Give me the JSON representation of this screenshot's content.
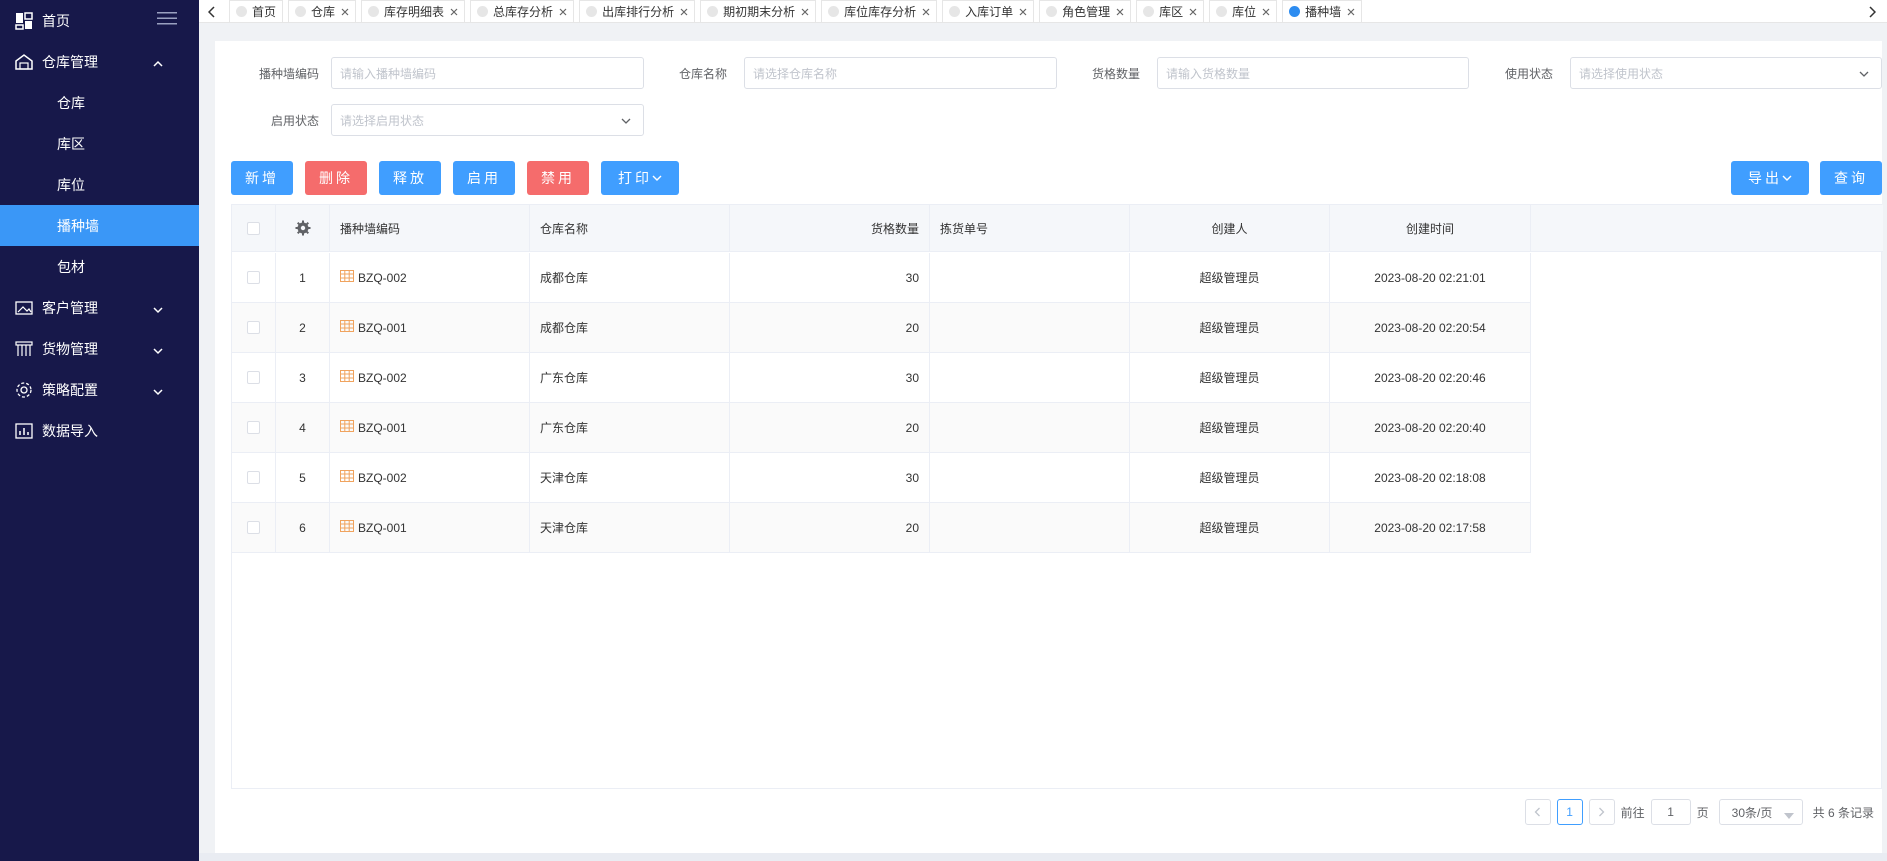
{
  "sidebar": {
    "home": "首页",
    "warehouse_mgmt": "仓库管理",
    "sub": [
      "仓库",
      "库区",
      "库位",
      "播种墙",
      "包材"
    ],
    "active_sub": 3,
    "customer_mgmt": "客户管理",
    "goods_mgmt": "货物管理",
    "strategy_config": "策略配置",
    "data_import": "数据导入"
  },
  "tabs": [
    {
      "label": "首页",
      "closable": false,
      "active": false
    },
    {
      "label": "仓库",
      "closable": true,
      "active": false
    },
    {
      "label": "库存明细表",
      "closable": true,
      "active": false
    },
    {
      "label": "总库存分析",
      "closable": true,
      "active": false
    },
    {
      "label": "出库排行分析",
      "closable": true,
      "active": false
    },
    {
      "label": "期初期末分析",
      "closable": true,
      "active": false
    },
    {
      "label": "库位库存分析",
      "closable": true,
      "active": false
    },
    {
      "label": "入库订单",
      "closable": true,
      "active": false
    },
    {
      "label": "角色管理",
      "closable": true,
      "active": false
    },
    {
      "label": "库区",
      "closable": true,
      "active": false
    },
    {
      "label": "库位",
      "closable": true,
      "active": false
    },
    {
      "label": "播种墙",
      "closable": true,
      "active": true
    }
  ],
  "filters": {
    "code_label": "播种墙编码",
    "code_placeholder": "请输入播种墙编码",
    "wh_label": "仓库名称",
    "wh_placeholder": "请选择仓库名称",
    "qty_label": "货格数量",
    "qty_placeholder": "请输入货格数量",
    "use_label": "使用状态",
    "use_placeholder": "请选择使用状态",
    "enable_label": "启用状态",
    "enable_placeholder": "请选择启用状态"
  },
  "toolbar": {
    "add": "新增",
    "delete": "删除",
    "release": "释放",
    "enable": "启用",
    "disable": "禁用",
    "print": "打印",
    "export": "导出",
    "query": "查询"
  },
  "table": {
    "headers": [
      "播种墙编码",
      "仓库名称",
      "货格数量",
      "拣货单号",
      "创建人",
      "创建时间"
    ],
    "rows": [
      {
        "idx": "1",
        "code": "BZQ-002",
        "warehouse": "成都仓库",
        "qty": "30",
        "pick": "",
        "creator": "超级管理员",
        "time": "2023-08-20 02:21:01"
      },
      {
        "idx": "2",
        "code": "BZQ-001",
        "warehouse": "成都仓库",
        "qty": "20",
        "pick": "",
        "creator": "超级管理员",
        "time": "2023-08-20 02:20:54"
      },
      {
        "idx": "3",
        "code": "BZQ-002",
        "warehouse": "广东仓库",
        "qty": "30",
        "pick": "",
        "creator": "超级管理员",
        "time": "2023-08-20 02:20:46"
      },
      {
        "idx": "4",
        "code": "BZQ-001",
        "warehouse": "广东仓库",
        "qty": "20",
        "pick": "",
        "creator": "超级管理员",
        "time": "2023-08-20 02:20:40"
      },
      {
        "idx": "5",
        "code": "BZQ-002",
        "warehouse": "天津仓库",
        "qty": "30",
        "pick": "",
        "creator": "超级管理员",
        "time": "2023-08-20 02:18:08"
      },
      {
        "idx": "6",
        "code": "BZQ-001",
        "warehouse": "天津仓库",
        "qty": "20",
        "pick": "",
        "creator": "超级管理员",
        "time": "2023-08-20 02:17:58"
      }
    ]
  },
  "pagination": {
    "current": "1",
    "goto_prefix": "前往",
    "goto_value": "1",
    "goto_suffix": "页",
    "page_size": "30条/页",
    "total": "共 6 条记录"
  },
  "colors": {
    "sidebar_bg": "#17184a",
    "accent": "#409eff",
    "danger": "#f56c6c",
    "active_menu": "#3a97f7",
    "code_icon": "#f0a35e"
  }
}
